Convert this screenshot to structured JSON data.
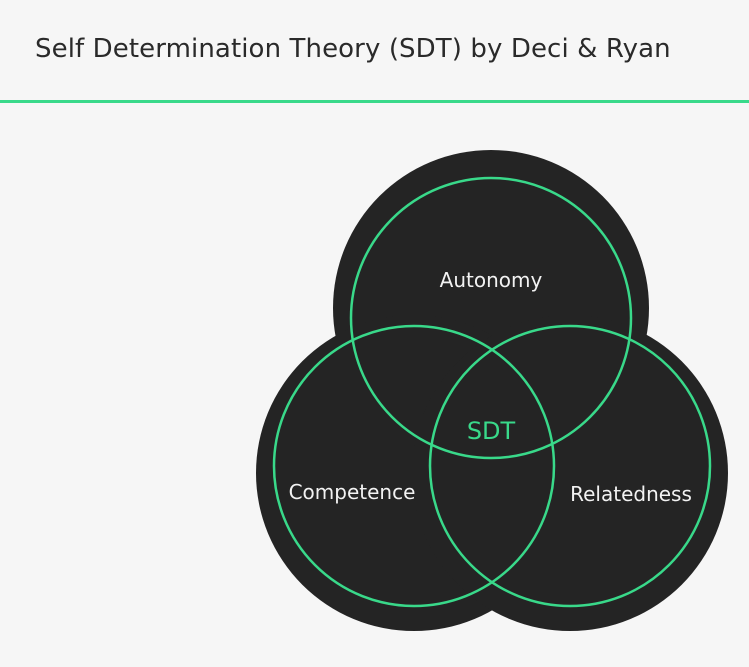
{
  "header": {
    "title": "Self Determination Theory (SDT) by Deci & Ryan"
  },
  "diagram": {
    "center_label": "SDT",
    "circles": [
      {
        "id": "autonomy",
        "label": "Autonomy"
      },
      {
        "id": "competence",
        "label": "Competence"
      },
      {
        "id": "relatedness",
        "label": "Relatedness"
      }
    ],
    "colors": {
      "fill": "#242424",
      "stroke": "#39d98a",
      "label": "#f2f2f2",
      "center_label": "#39d98a",
      "background": "#f6f6f6",
      "accent_line": "#39d98a"
    }
  }
}
